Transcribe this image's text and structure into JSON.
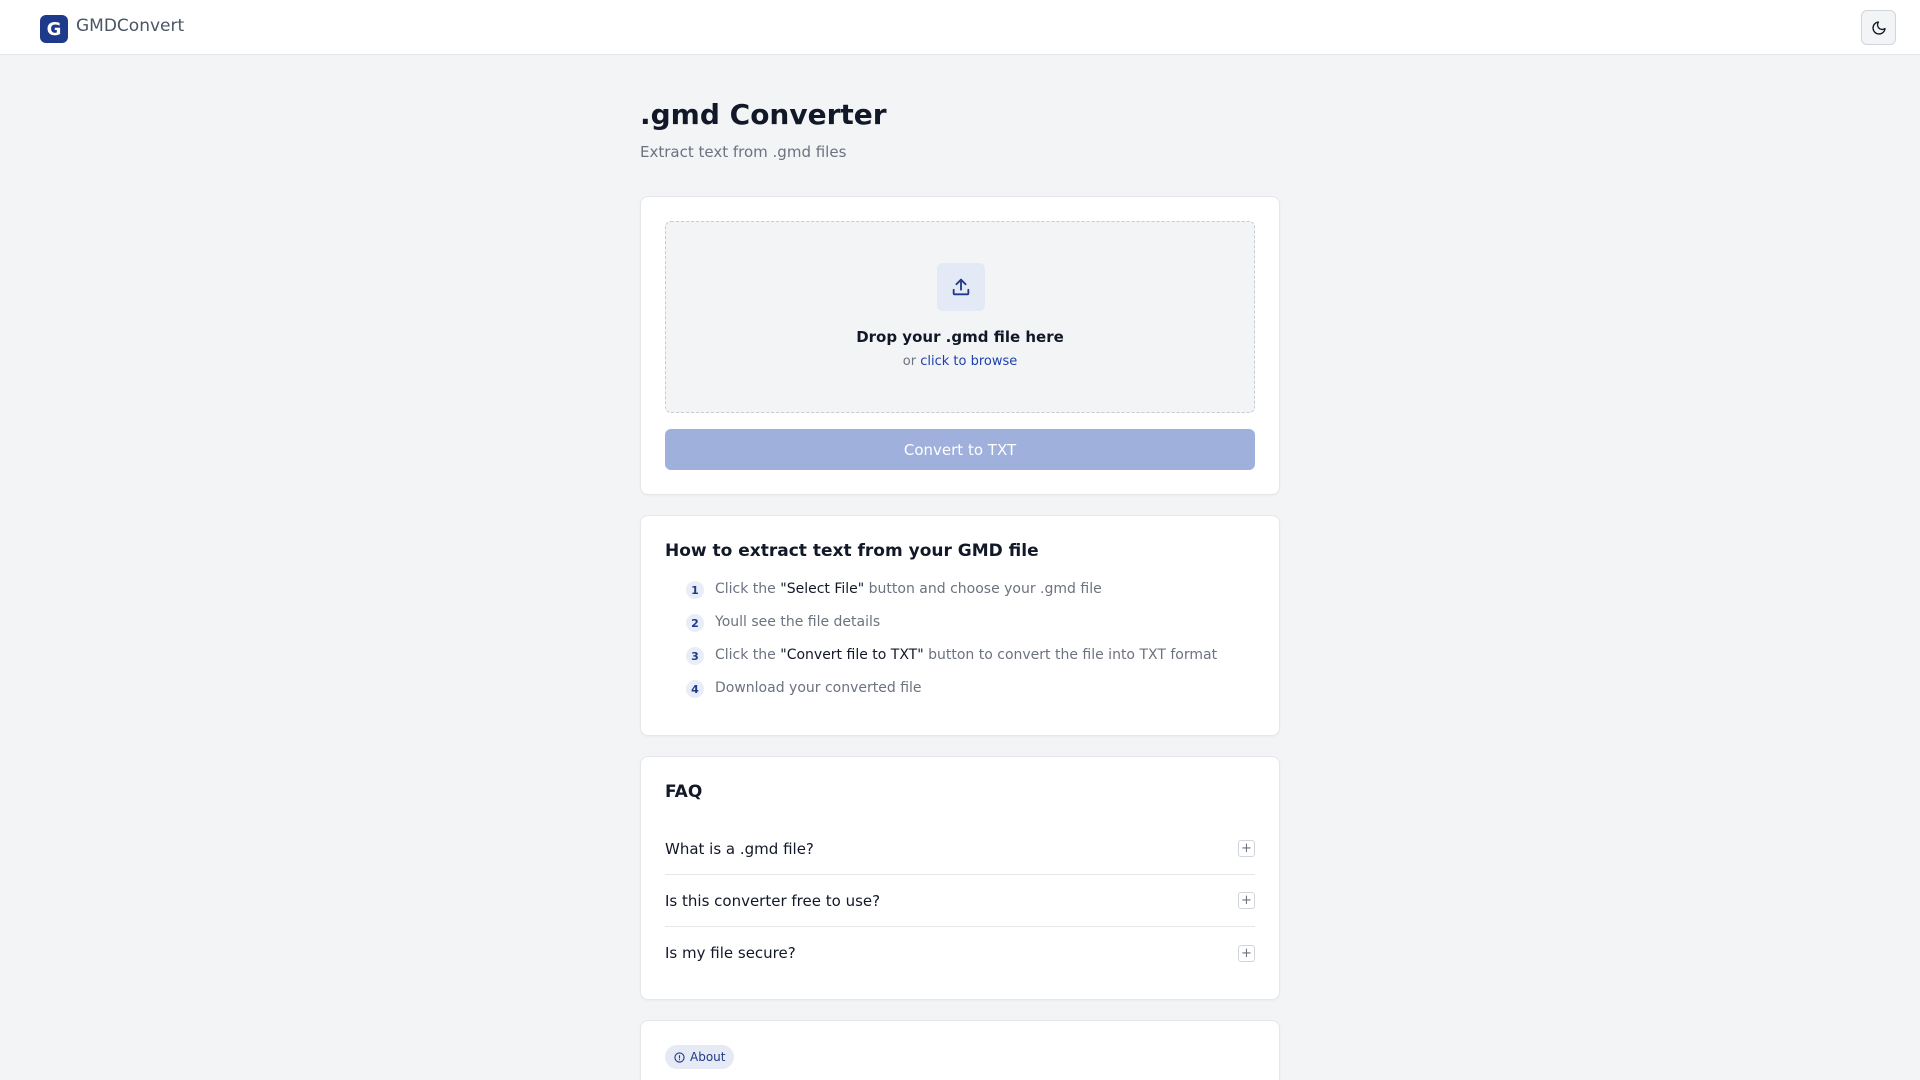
{
  "app": {
    "logo_letter": "G",
    "brand": "GMDConvert",
    "theme_toggle_icon": "moon-icon"
  },
  "page": {
    "title": ".gmd Converter",
    "subtitle": "Extract text from .gmd files"
  },
  "upload": {
    "icon": "upload-icon",
    "title": "Drop your .gmd file here",
    "or_text": "or",
    "browse_link": "click to browse",
    "convert_button": "Convert to TXT",
    "convert_button_disabled": true
  },
  "howto": {
    "heading": "How to extract text from your GMD file",
    "steps": [
      {
        "num": "1",
        "before": "Click the ",
        "em": "\"Select File\"",
        "after": " button and choose your .gmd file"
      },
      {
        "num": "2",
        "before": "Youll see the file details",
        "em": "",
        "after": ""
      },
      {
        "num": "3",
        "before": "Click the ",
        "em": "\"Convert file to TXT\"",
        "after": " button to convert the file into TXT format"
      },
      {
        "num": "4",
        "before": "Download your converted file",
        "em": "",
        "after": ""
      }
    ]
  },
  "faq": {
    "heading": "FAQ",
    "toggle_symbol": "+",
    "items": [
      {
        "question": "What is a .gmd file?"
      },
      {
        "question": "Is this converter free to use?"
      },
      {
        "question": "Is my file secure?"
      }
    ]
  },
  "about": {
    "badge": "About",
    "icon": "info-icon"
  },
  "colors": {
    "brand": "#1e3a8a",
    "button_disabled": "#9fb0dc",
    "background": "#f3f4f6"
  }
}
